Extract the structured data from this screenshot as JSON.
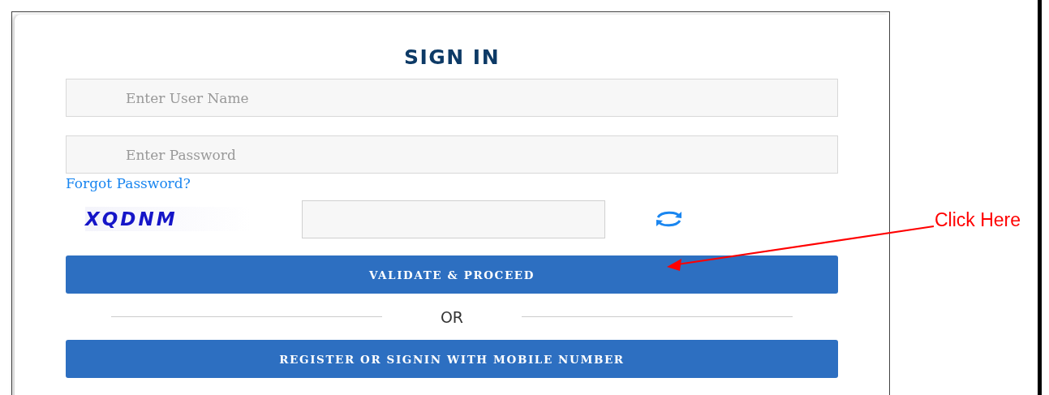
{
  "title": "SIGN IN",
  "fields": [
    {
      "placeholder": "Enter User Name"
    },
    {
      "placeholder": "Enter Password"
    }
  ],
  "forgot_link": "Forgot Password?",
  "captcha": {
    "text": "XQDNM"
  },
  "validate_button": "VALIDATE & PROCEED",
  "divider_text": "OR",
  "mobile_button": "REGISTER OR SIGNIN WITH MOBILE NUMBER",
  "annotation": {
    "text": "Click Here"
  }
}
